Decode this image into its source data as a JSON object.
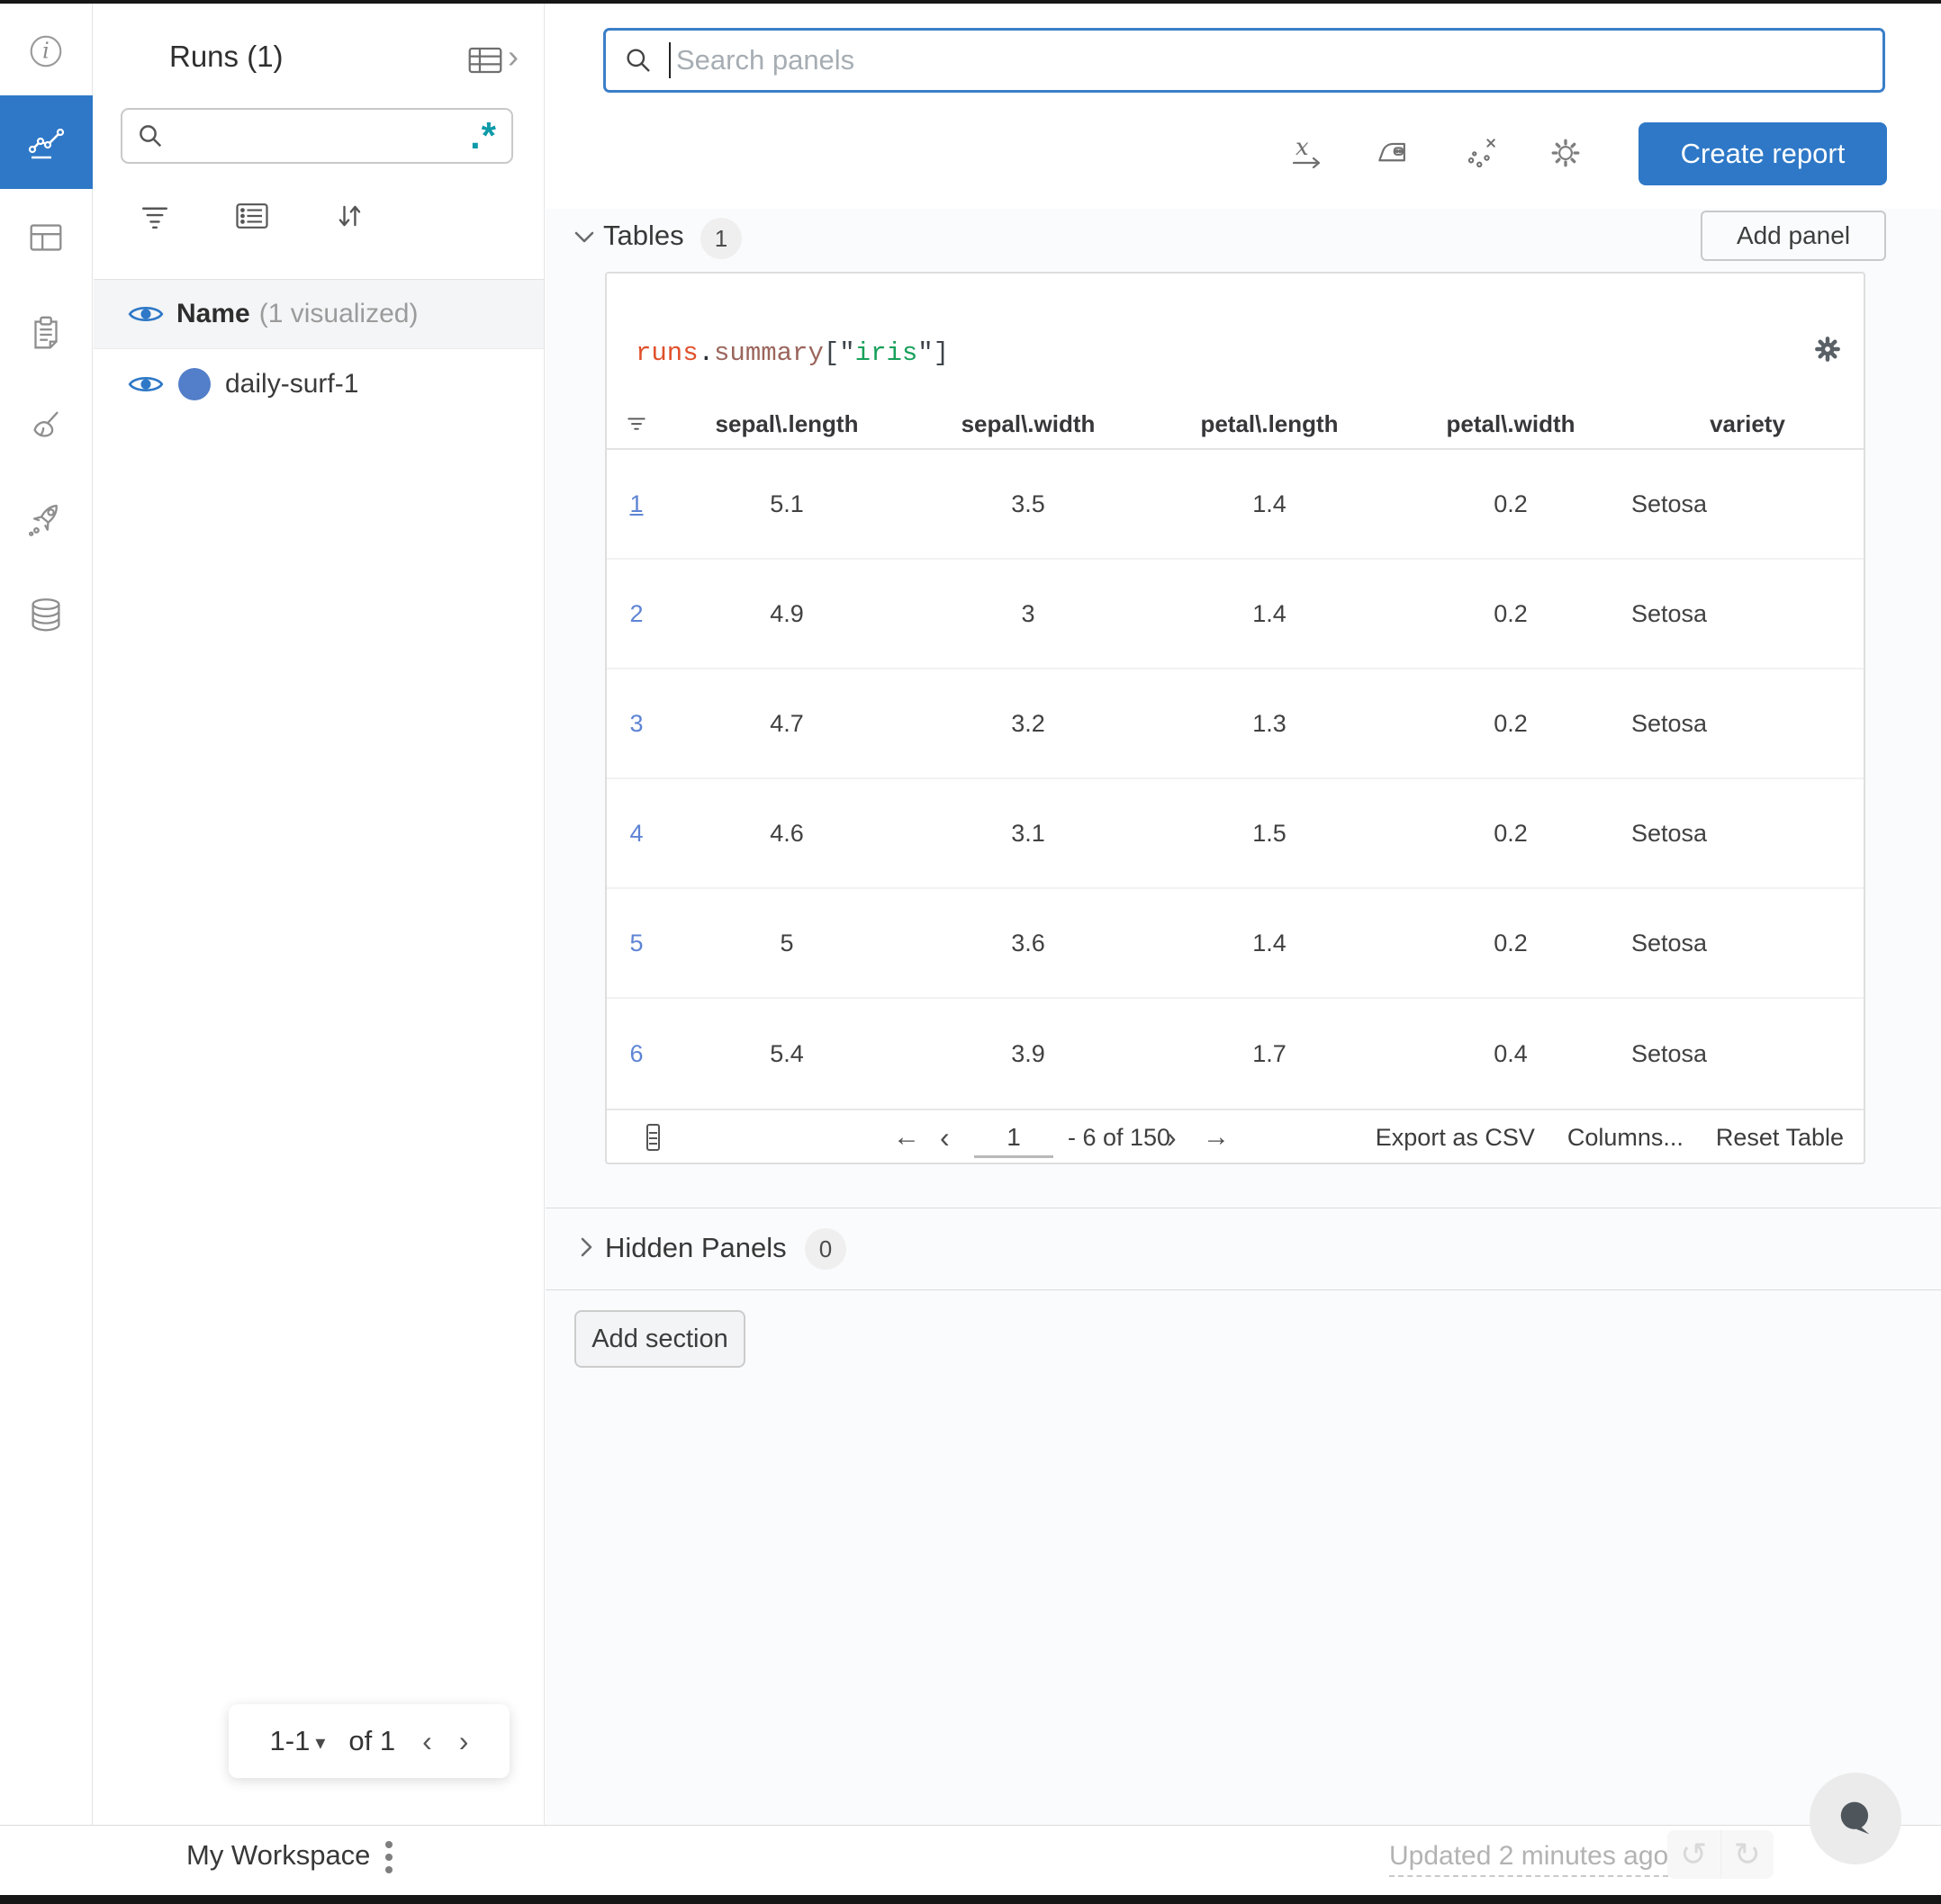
{
  "colors": {
    "accent_blue": "#2e78c7",
    "focus_border": "#3b7fc8",
    "run_dot_blue": "#537ec9",
    "row_index_blue": "#5e84d4",
    "regex_teal": "#0d9aa8",
    "code_runs": "#e0502b",
    "code_summary": "#9b655c",
    "code_string": "#16a05a"
  },
  "glyphs": {
    "chevron_right": "›",
    "nav_first": "←",
    "nav_prev": "‹",
    "nav_next": "›",
    "nav_last": "→",
    "caret_down": "▾",
    "undo": "↺",
    "redo": "↻",
    "regex": ".*",
    "info": "i"
  },
  "rail": {
    "items": [
      "info-icon",
      "line-chart-icon (active)",
      "layout-grid-icon",
      "clipboard-icon",
      "broom-icon",
      "rocket-icon",
      "database-icon"
    ]
  },
  "sidebar": {
    "title": "Runs (1)",
    "search_value": "",
    "name_label": "Name",
    "visualized_label": "(1 visualized)",
    "run_name": "daily-surf-1",
    "pagination": {
      "range": "1-1",
      "of": "of 1"
    }
  },
  "main": {
    "search_placeholder": "Search panels",
    "create_report_label": "Create report",
    "add_panel_label": "Add panel",
    "tables_label": "Tables",
    "tables_count": "1",
    "hidden_label": "Hidden Panels",
    "hidden_count": "0",
    "add_section_label": "Add section"
  },
  "panel": {
    "code": {
      "t1": "runs",
      "t2": ".",
      "t3": "summary",
      "t4": "[\"",
      "t5": "iris",
      "t6": "\"]"
    },
    "table": {
      "headers": [
        "sepal\\.length",
        "sepal\\.width",
        "petal\\.length",
        "petal\\.width",
        "variety"
      ],
      "rows": [
        {
          "index": "1",
          "cells": [
            "5.1",
            "3.5",
            "1.4",
            "0.2",
            "Setosa"
          ]
        },
        {
          "index": "2",
          "cells": [
            "4.9",
            "3",
            "1.4",
            "0.2",
            "Setosa"
          ]
        },
        {
          "index": "3",
          "cells": [
            "4.7",
            "3.2",
            "1.3",
            "0.2",
            "Setosa"
          ]
        },
        {
          "index": "4",
          "cells": [
            "4.6",
            "3.1",
            "1.5",
            "0.2",
            "Setosa"
          ]
        },
        {
          "index": "5",
          "cells": [
            "5",
            "3.6",
            "1.4",
            "0.2",
            "Setosa"
          ]
        },
        {
          "index": "6",
          "cells": [
            "5.4",
            "3.9",
            "1.7",
            "0.4",
            "Setosa"
          ]
        }
      ]
    },
    "footer": {
      "page": "1",
      "range": "- 6 of 150",
      "export_label": "Export as CSV",
      "columns_label": "Columns...",
      "reset_label": "Reset Table"
    }
  },
  "statusbar": {
    "workspace": "My Workspace",
    "updated": "Updated 2 minutes ago"
  }
}
